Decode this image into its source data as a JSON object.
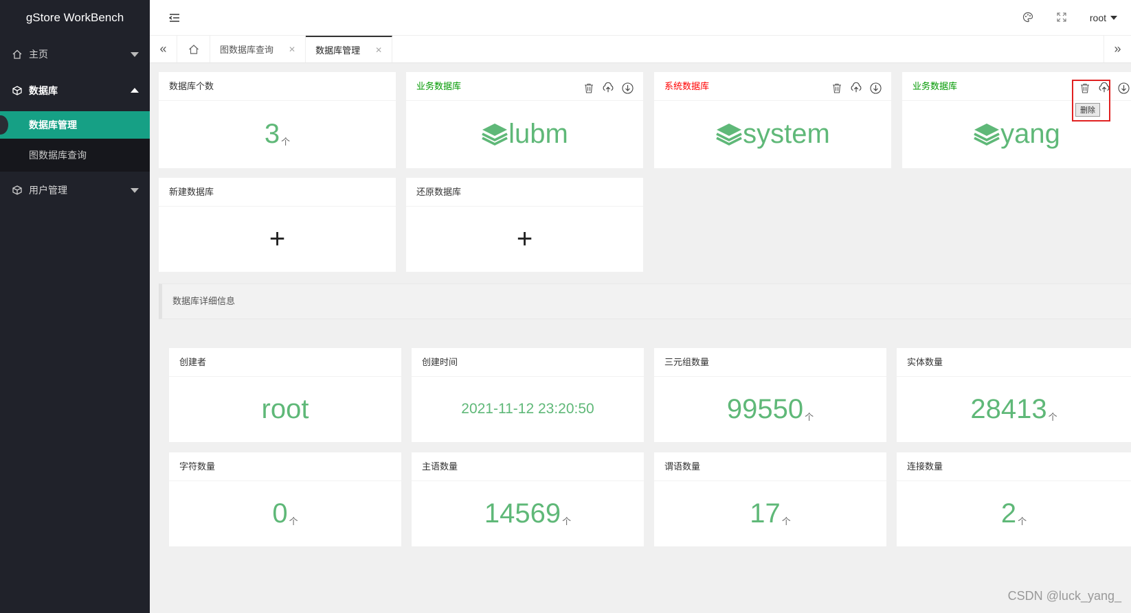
{
  "app": {
    "title": "gStore WorkBench"
  },
  "sidebar": {
    "items": [
      {
        "label": "主页",
        "icon": "home-icon"
      },
      {
        "label": "数据库",
        "icon": "cube-icon",
        "expanded": true,
        "children": [
          {
            "label": "数据库管理",
            "active": true
          },
          {
            "label": "图数据库查询"
          }
        ]
      },
      {
        "label": "用户管理",
        "icon": "cube-icon"
      }
    ]
  },
  "header": {
    "user": "root"
  },
  "tabs": [
    {
      "label": "图数据库查询"
    },
    {
      "label": "数据库管理",
      "active": true
    }
  ],
  "db_count": {
    "title": "数据库个数",
    "value": "3",
    "unit": "个"
  },
  "databases": [
    {
      "type_label": "业务数据库",
      "type_color": "#009900",
      "name": "lubm"
    },
    {
      "type_label": "系统数据库",
      "type_color": "#ff0000",
      "name": "system"
    },
    {
      "type_label": "业务数据库",
      "type_color": "#009900",
      "name": "yang"
    }
  ],
  "delete_tooltip": "删除",
  "new_db": {
    "title": "新建数据库",
    "symbol": "+"
  },
  "restore_db": {
    "title": "还原数据库",
    "symbol": "+"
  },
  "detail_title": "数据库详细信息",
  "details": [
    {
      "title": "创建者",
      "value": "root",
      "unit": ""
    },
    {
      "title": "创建时间",
      "value": "2021-11-12 23:20:50",
      "unit": ""
    },
    {
      "title": "三元组数量",
      "value": "99550",
      "unit": "个"
    },
    {
      "title": "实体数量",
      "value": "28413",
      "unit": "个"
    },
    {
      "title": "字符数量",
      "value": "0",
      "unit": "个"
    },
    {
      "title": "主语数量",
      "value": "14569",
      "unit": "个"
    },
    {
      "title": "谓语数量",
      "value": "17",
      "unit": "个"
    },
    {
      "title": "连接数量",
      "value": "2",
      "unit": "个"
    }
  ],
  "watermark": "CSDN @luck_yang_"
}
